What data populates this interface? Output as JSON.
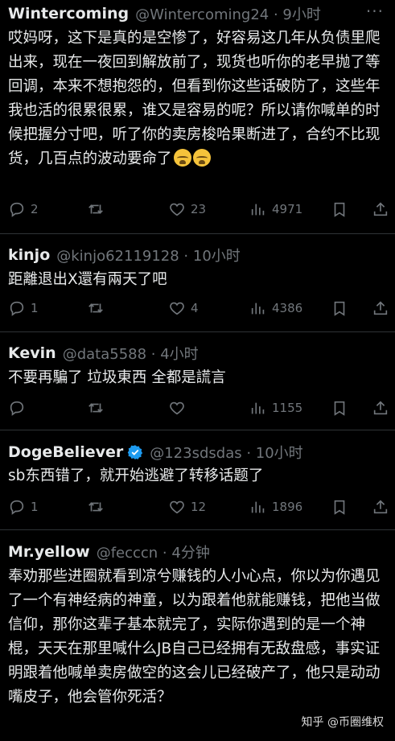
{
  "tweets": [
    {
      "name": "Wintercoming",
      "handle": "@Wintercoming24 · 9小时",
      "text": "哎妈呀，这下是真的是空惨了，好容易这几年从负债里爬出来，现在一夜回到解放前了，现货也听你的老早抛了等回调，本来不想抱怨的，但看到你这些话破防了，这些年我也活的很累很累，谁又是容易的呢？所以请你喊单的时候把握分寸吧，听了你的卖房梭哈果断进了，合约不比现货，几百点的波动要命了",
      "emoji_icons": [
        "loudly-crying-face-icon",
        "loudly-crying-face-icon"
      ],
      "replies": "2",
      "retweets": "",
      "likes": "23",
      "views": "4971"
    },
    {
      "name": "kinjo",
      "handle": "@kinjo62119128 · 10小时",
      "text": "距離退出X還有兩天了吧",
      "replies": "1",
      "retweets": "",
      "likes": "4",
      "views": "4386"
    },
    {
      "name": "Kevin",
      "handle": "@data5588 · 4小时",
      "text": "不要再騙了 垃圾東西 全都是謊言",
      "replies": "",
      "retweets": "",
      "likes": "",
      "views": "1155"
    },
    {
      "name": "DogeBeliever",
      "handle": "@123sdsdas · 10小时",
      "text": "sb东西错了，就开始逃避了转移话题了",
      "replies": "1",
      "retweets": "",
      "likes": "12",
      "views": "1896"
    },
    {
      "name": "Mr.yellow",
      "handle": "@fecccn · 4分钟",
      "text": "奉劝那些进圈就看到凉兮赚钱的人小心点，你以为你遇见了一个有神经病的神童，以为跟着他就能赚钱，把他当做信仰，那你这辈子基本就完了，实际你遇到的是一个神棍，天天在那里喊什么JB自己已经拥有无敌盘感，事实证明跟着他喊单卖房做空的这会儿已经破产了，他只是动动嘴皮子，他会管你死活？"
    }
  ],
  "more_label": "···",
  "watermark": "知乎 @币圈维权",
  "colors": {
    "background": "#000000",
    "text": "#e7e9ea",
    "muted": "#71767b",
    "divider": "#2f3336",
    "verified": "#1d9bf0"
  }
}
